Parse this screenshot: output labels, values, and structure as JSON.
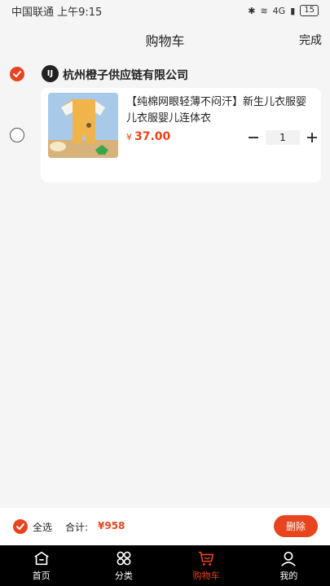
{
  "status": {
    "carrier_time": "中国联通 上午9:15",
    "battery": "15",
    "signal_text": "4G"
  },
  "header": {
    "title": "购物车",
    "done_label": "完成"
  },
  "shop": {
    "logo_text": "IJ",
    "name": "杭州橙子供应链有限公司",
    "checked": true
  },
  "items": [
    {
      "title": "【纯棉网眼轻薄不闷汗】新生儿衣服婴儿衣服婴儿连体衣",
      "currency": "¥",
      "price": "37.00",
      "quantity": "1",
      "checked": false
    }
  ],
  "footer": {
    "select_all_label": "全选",
    "total_label": "合计:",
    "total_value": "¥958",
    "delete_label": "删除"
  },
  "tabs": [
    {
      "label": "首页",
      "icon": "home-icon",
      "active": false
    },
    {
      "label": "分类",
      "icon": "category-icon",
      "active": false
    },
    {
      "label": "购物车",
      "icon": "cart-icon",
      "active": true
    },
    {
      "label": "我的",
      "icon": "profile-icon",
      "active": false
    }
  ],
  "colors": {
    "accent": "#e8441f",
    "tab_bar_bg": "#000000",
    "page_bg": "#f5f5f5"
  }
}
